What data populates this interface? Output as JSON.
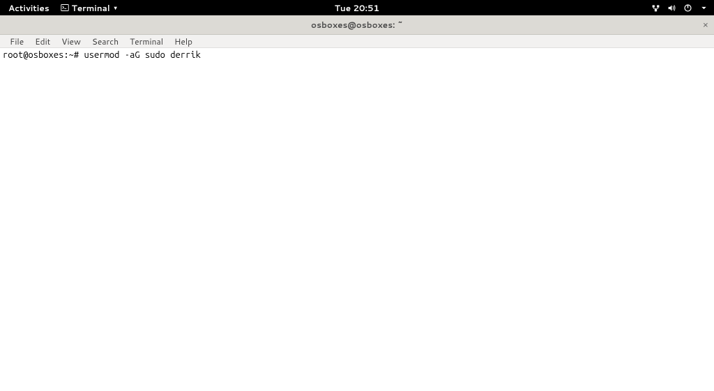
{
  "top_panel": {
    "activities": "Activities",
    "app_name": "Terminal",
    "clock": "Tue 20:51"
  },
  "window": {
    "title": "osboxes@osboxes: ~",
    "close_symbol": "×"
  },
  "menubar": {
    "file": "File",
    "edit": "Edit",
    "view": "View",
    "search": "Search",
    "terminal": "Terminal",
    "help": "Help"
  },
  "terminal": {
    "prompt": "root@osboxes:~# ",
    "command": "usermod -aG sudo derrik"
  }
}
